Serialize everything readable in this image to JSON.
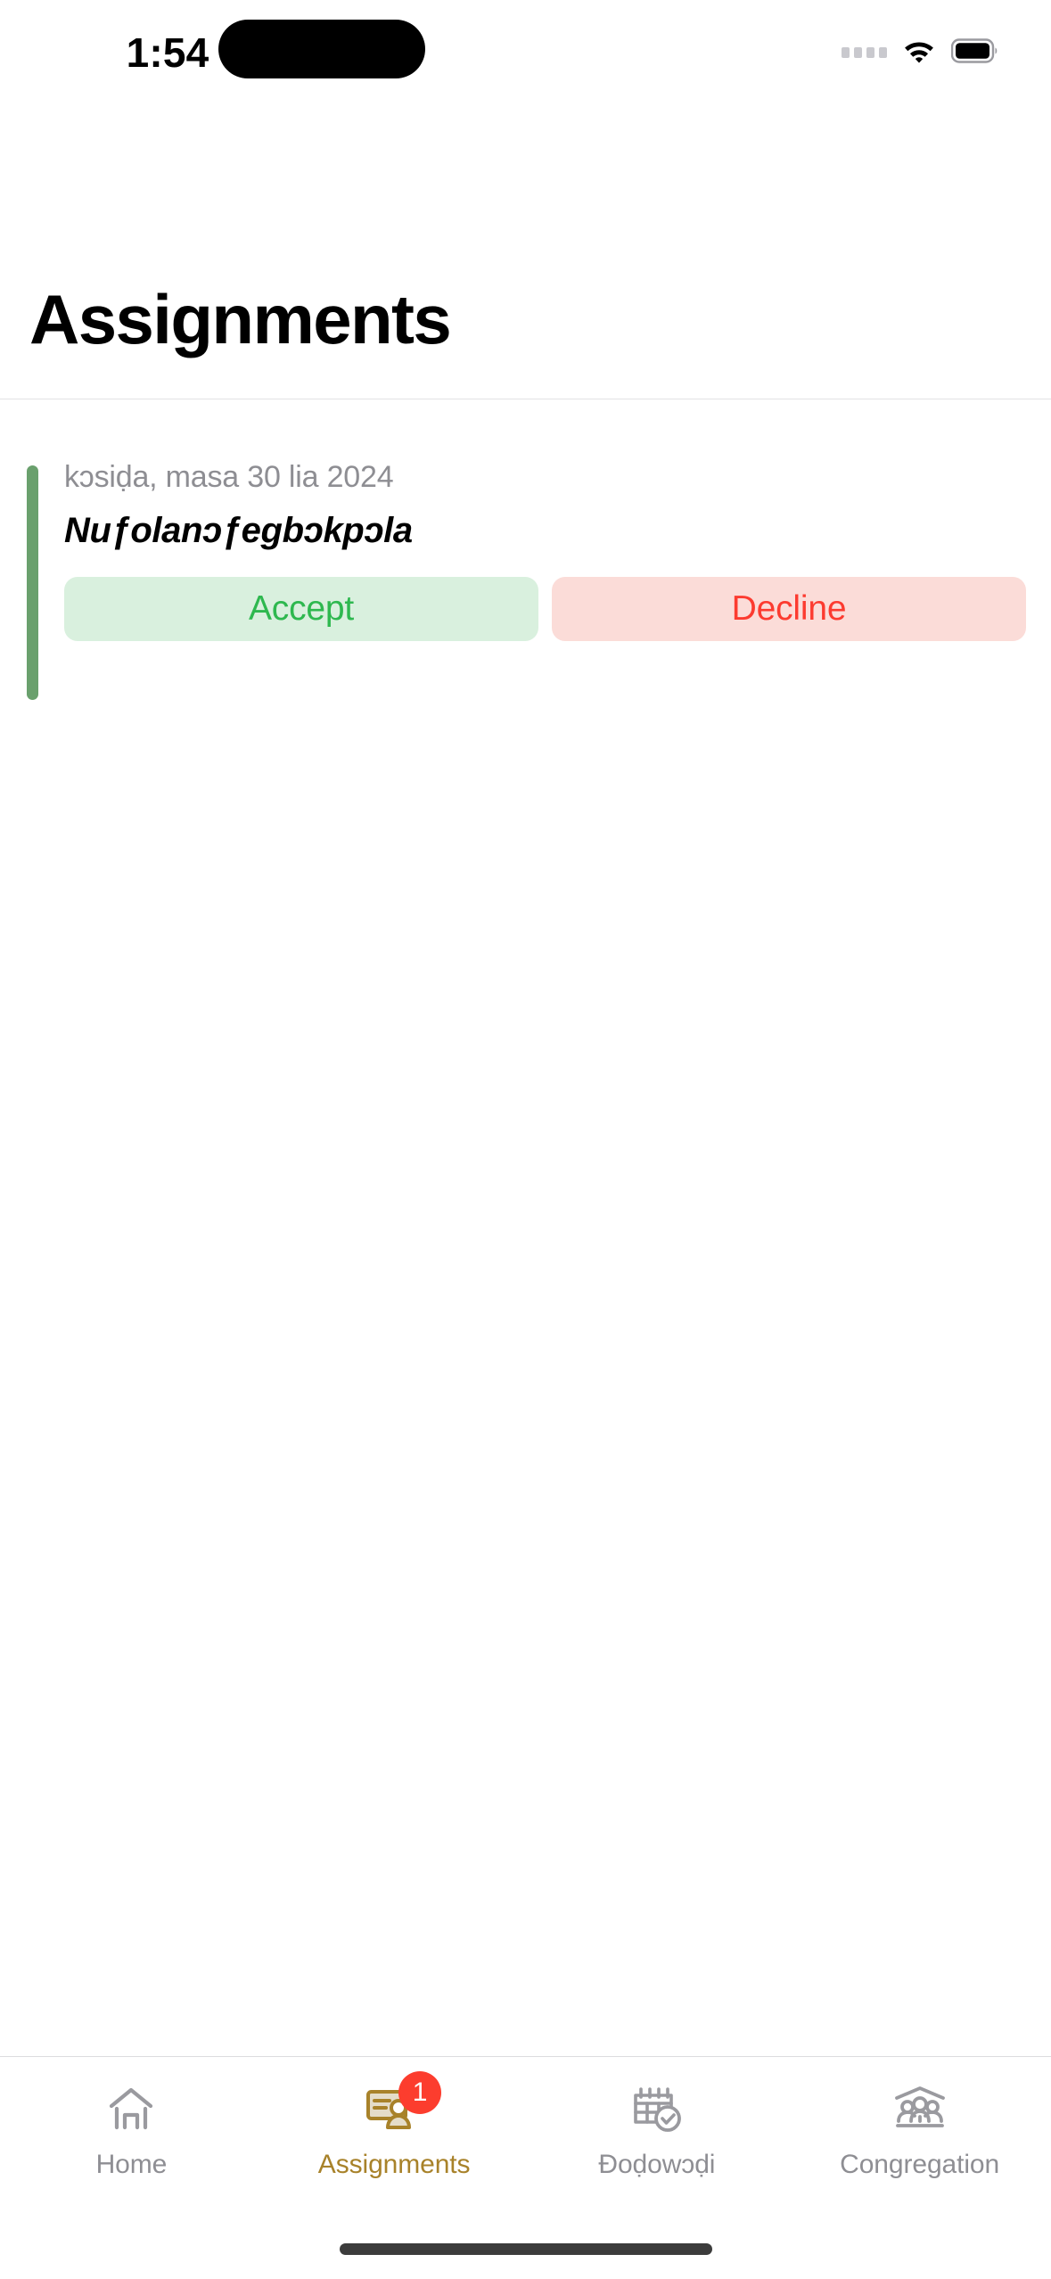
{
  "status_bar": {
    "time": "1:54",
    "signal_icon": "signal-dots-icon",
    "wifi_icon": "wifi-icon",
    "battery_icon": "battery-icon"
  },
  "header": {
    "title": "Assignments"
  },
  "assignments": [
    {
      "accent_color": "#6aa06d",
      "date": "kɔsiḍa, masa 30 lia 2024",
      "name": "Nuƒolanɔƒegbɔkpɔla",
      "accept_label": "Accept",
      "decline_label": "Decline"
    }
  ],
  "tab_bar": {
    "active_color": "#a8822a",
    "inactive_color": "#8e8e93",
    "items": [
      {
        "id": "home",
        "label": "Home",
        "icon": "house-icon",
        "active": false,
        "badge": ""
      },
      {
        "id": "assignments",
        "label": "Assignments",
        "icon": "id-card-person-icon",
        "active": true,
        "badge": "1"
      },
      {
        "id": "dodowodi",
        "label": "Ðoḍowɔḍi",
        "icon": "calendar-check-icon",
        "active": false,
        "badge": ""
      },
      {
        "id": "congregation",
        "label": "Congregation",
        "icon": "people-roof-icon",
        "active": false,
        "badge": ""
      }
    ]
  }
}
